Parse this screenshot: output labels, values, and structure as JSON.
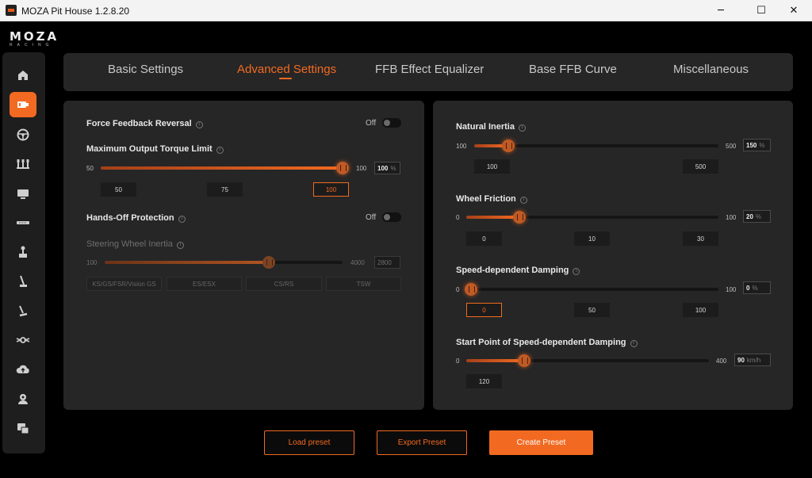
{
  "window": {
    "title": "MOZA Pit House 1.2.8.20",
    "min": "─",
    "max": "☐",
    "close": "✕"
  },
  "brand": {
    "main": "MOZA",
    "sub": "RACING"
  },
  "accent_color": "#f26a21",
  "sidebar": {
    "items": [
      {
        "icon": "home-icon"
      },
      {
        "icon": "wheelbase-icon",
        "active": true
      },
      {
        "icon": "steering-wheel-icon"
      },
      {
        "icon": "pedals-icon"
      },
      {
        "icon": "dashboard-icon"
      },
      {
        "icon": "display-bar-icon"
      },
      {
        "icon": "shifter-icon"
      },
      {
        "icon": "handbrake-icon"
      },
      {
        "icon": "hub-icon"
      },
      {
        "icon": "accessory-icon"
      },
      {
        "icon": "cloud-upload-icon"
      },
      {
        "icon": "user-icon"
      },
      {
        "icon": "help-icon"
      }
    ]
  },
  "tabs": [
    "Basic Settings",
    "Advanced Settings",
    "FFB Effect Equalizer",
    "Base FFB Curve",
    "Miscellaneous"
  ],
  "active_tab": "Advanced Settings",
  "left": {
    "ffb_reversal": {
      "label": "Force Feedback Reversal",
      "state": "Off"
    },
    "max_torque": {
      "label": "Maximum Output Torque Limit",
      "min": "50",
      "max": "100",
      "value": "100",
      "unit": "%",
      "presets": [
        "50",
        "75",
        "100"
      ],
      "selected": "100"
    },
    "hands_off": {
      "label": "Hands-Off Protection",
      "state": "Off"
    },
    "wheel_inertia": {
      "label": "Steering Wheel Inertia",
      "min": "100",
      "max": "4000",
      "value": "2800",
      "presets": [
        "KS/GS/FSR/Vision GS",
        "ES/ESX",
        "CS/RS",
        "TSW"
      ]
    }
  },
  "right": {
    "natural_inertia": {
      "label": "Natural Inertia",
      "min": "100",
      "max": "500",
      "value": "150",
      "unit": "%",
      "presets": [
        "100",
        "500"
      ]
    },
    "wheel_friction": {
      "label": "Wheel Friction",
      "min": "0",
      "max": "100",
      "value": "20",
      "unit": "%",
      "presets": [
        "0",
        "10",
        "30"
      ]
    },
    "speed_damping": {
      "label": "Speed-dependent Damping",
      "min": "0",
      "max": "100",
      "value": "0",
      "unit": "%",
      "presets": [
        "0",
        "50",
        "100"
      ],
      "selected": "0"
    },
    "damping_start": {
      "label": "Start Point of Speed-dependent Damping",
      "min": "0",
      "max": "400",
      "value": "90",
      "unit": "km/h",
      "presets": [
        "120"
      ]
    }
  },
  "buttons": {
    "load": "Load preset",
    "export": "Export Preset",
    "create": "Create Preset"
  }
}
